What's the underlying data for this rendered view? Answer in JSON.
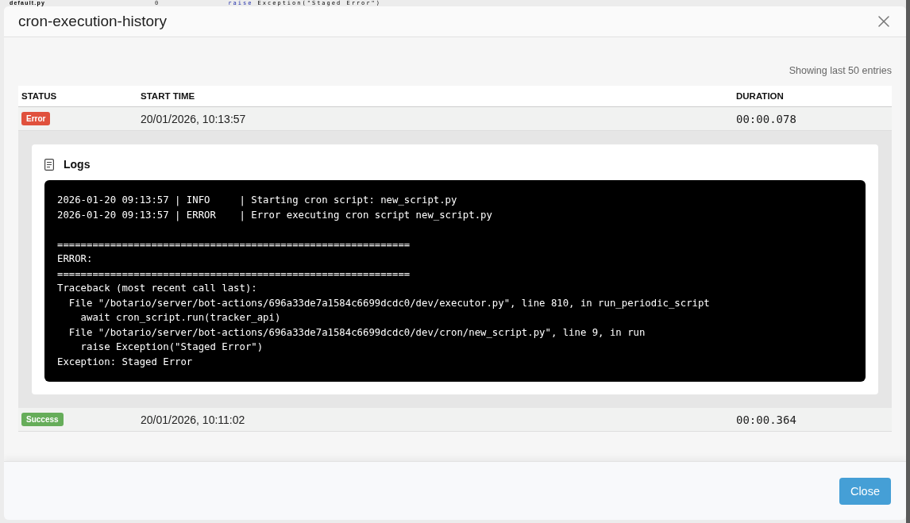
{
  "background": {
    "file_name": "default.py",
    "line_number": "0",
    "code_keyword": "raise",
    "code_rest": "Exception(\"Staged Error\")"
  },
  "dialog": {
    "title": "cron-execution-history",
    "summary": "Showing last 50 entries",
    "table": {
      "columns": [
        "STATUS",
        "START TIME",
        "DURATION"
      ],
      "rows": [
        {
          "status": "Error",
          "color": "#e0513d",
          "start_time": "20/01/2026, 10:13:57",
          "duration": "00:00.078",
          "expanded": true,
          "details": {
            "title": "Logs",
            "log_blocks": [
              [
                "2026-01-20 09:13:57 | INFO     | Starting cron script: new_script.py",
                "2026-01-20 09:13:57 | ERROR    | Error executing cron script new_script.py"
              ],
              [
                "============================================================",
                "ERROR:",
                "============================================================",
                "Traceback (most recent call last):",
                "  File \"/botario/server/bot-actions/696a33de7a1584c6699dcdc0/dev/executor.py\", line 810, in run_periodic_script",
                "    await cron_script.run(tracker_api)",
                "  File \"/botario/server/bot-actions/696a33de7a1584c6699dcdc0/dev/cron/new_script.py\", line 9, in run",
                "    raise Exception(\"Staged Error\")",
                "Exception: Staged Error"
              ]
            ]
          }
        },
        {
          "status": "Success",
          "color": "#66ad5a",
          "start_time": "20/01/2026, 10:11:02",
          "duration": "00:00.364",
          "expanded": false
        }
      ]
    },
    "buttons": [
      "Close"
    ]
  }
}
